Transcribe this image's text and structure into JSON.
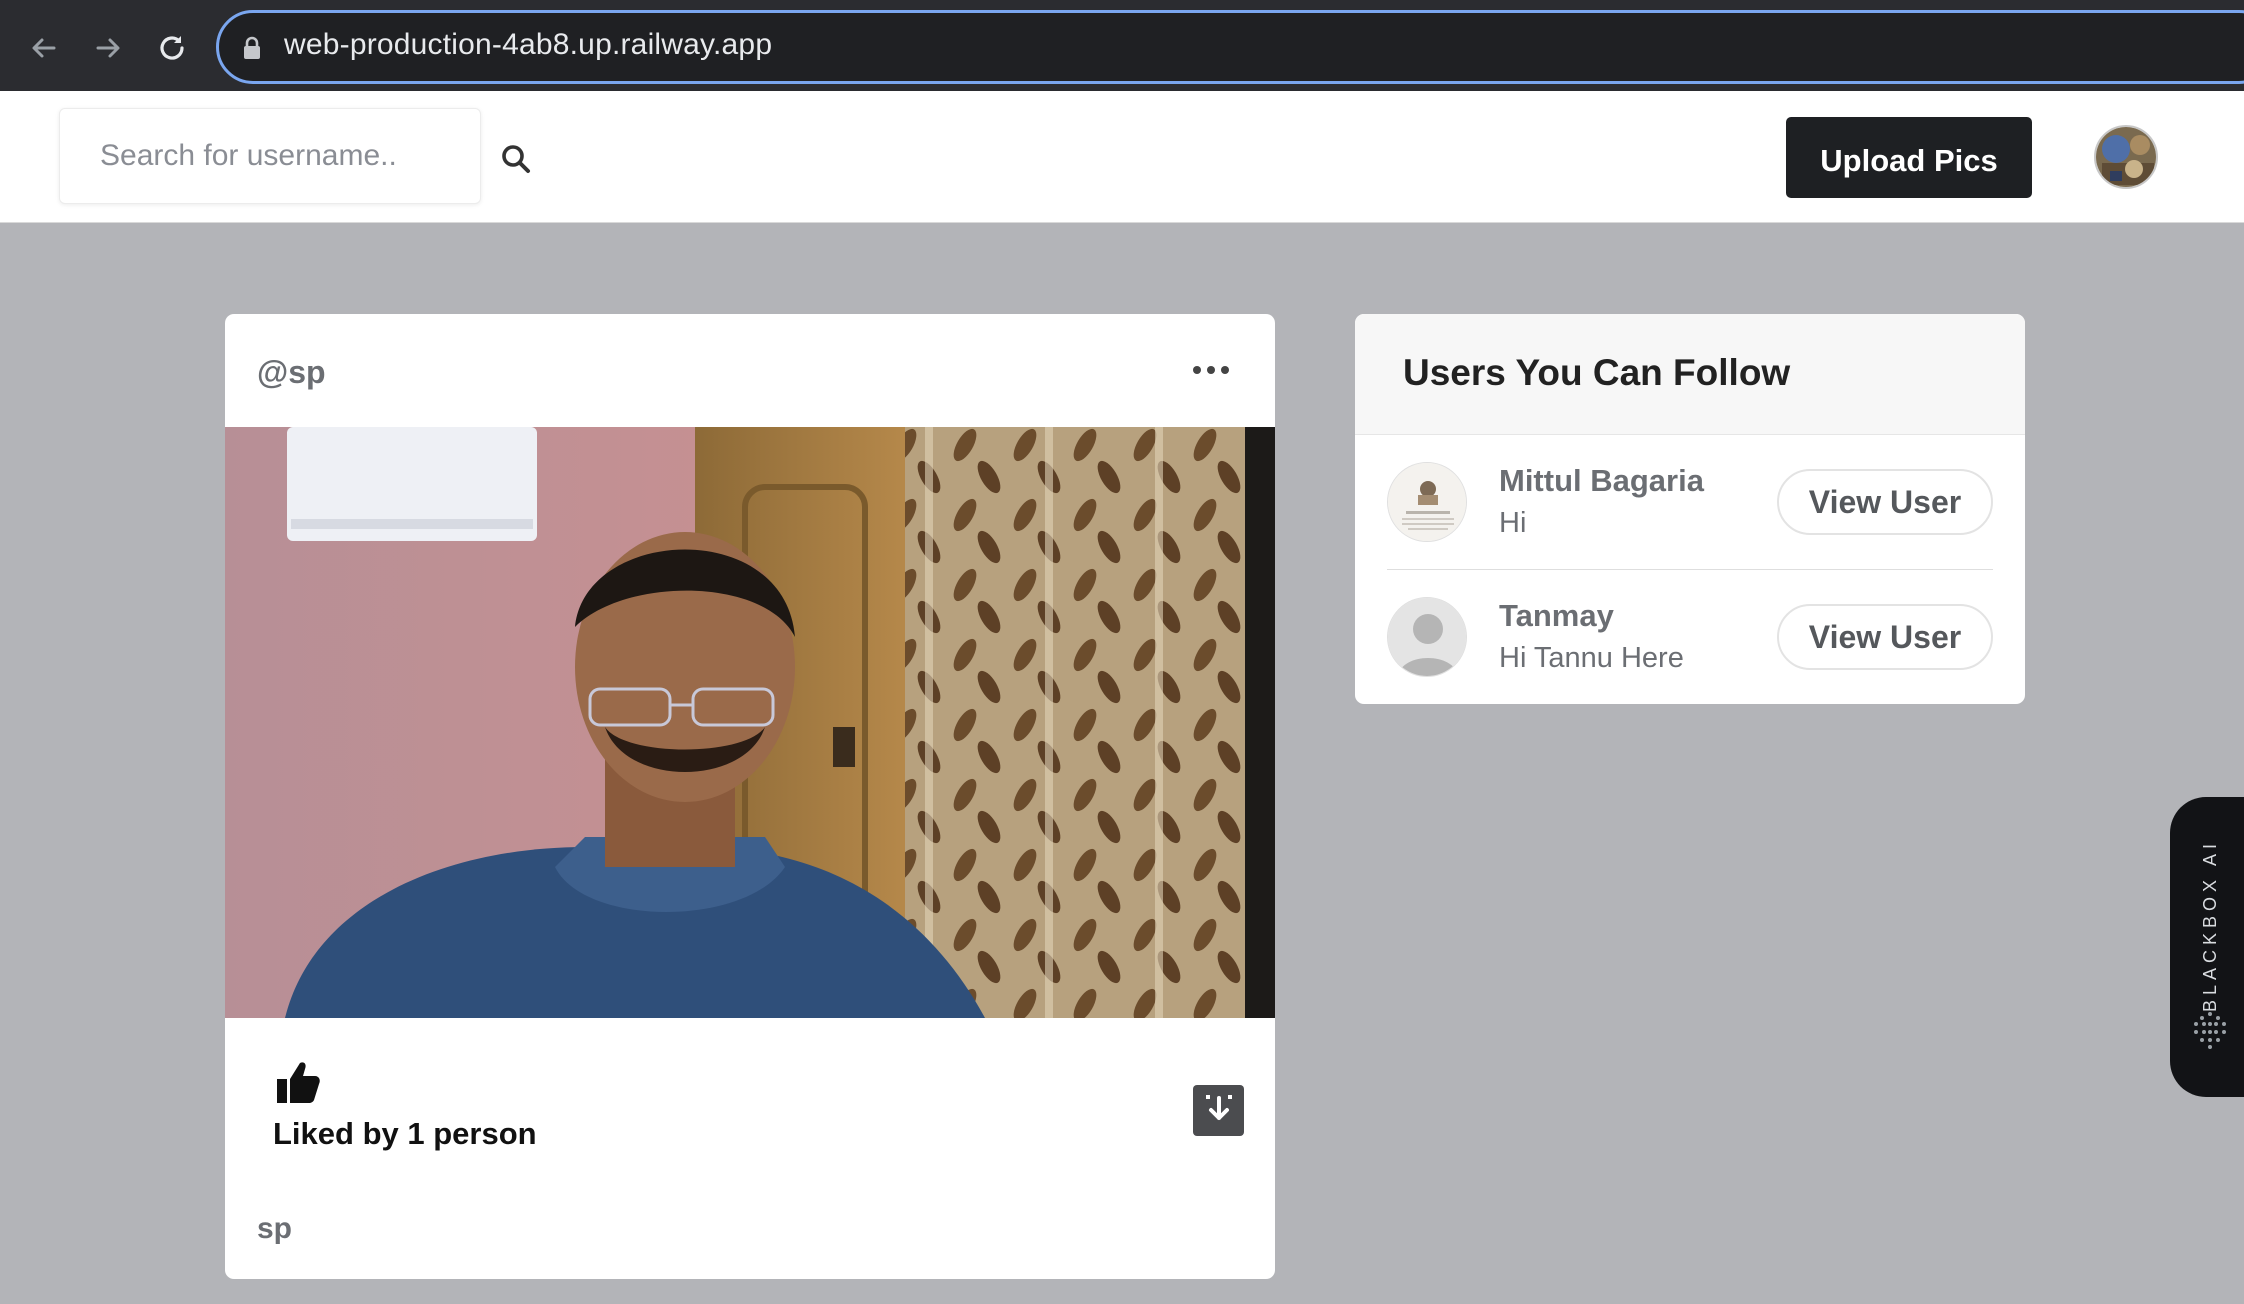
{
  "browser": {
    "url": "web-production-4ab8.up.railway.app",
    "icons": [
      "back-arrow-icon",
      "forward-arrow-icon",
      "reload-icon",
      "lock-icon"
    ]
  },
  "header": {
    "search_placeholder": "Search for username..",
    "upload_label": "Upload Pics"
  },
  "post": {
    "username": "@sp",
    "liked_text": "Liked by 1 person",
    "caption_username": "sp"
  },
  "suggestions": {
    "title": "Users You Can Follow",
    "users": [
      {
        "name": "Mittul Bagaria",
        "bio": "Hi",
        "button": "View User"
      },
      {
        "name": "Tanmay",
        "bio": "Hi Tannu Here",
        "button": "View User"
      }
    ]
  },
  "side_tab": {
    "label": "BLACKBOX AI"
  },
  "colors": {
    "page_background": "#b3b4b8",
    "header_button": "#1e2023",
    "url_focus_ring": "#7aa6ef"
  }
}
